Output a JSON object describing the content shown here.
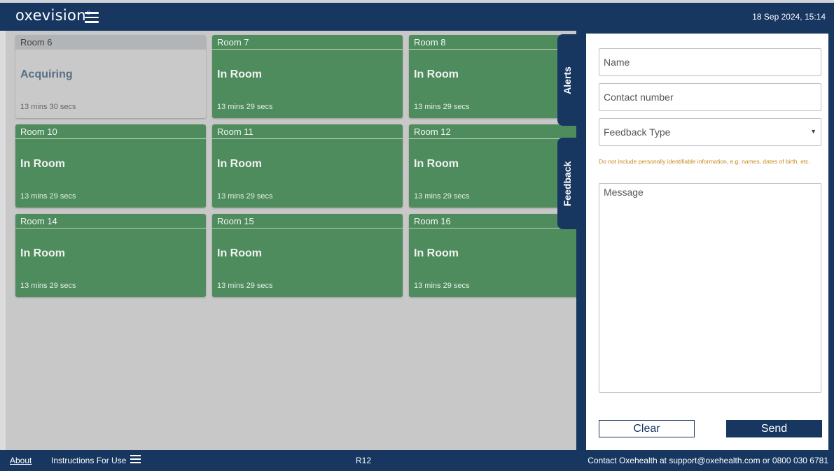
{
  "header": {
    "logo_text": "oxevision",
    "logo_mark": "®",
    "datetime": "18 Sep 2024, 15:14"
  },
  "rooms": [
    {
      "name": "Room 6",
      "status": "Acquiring",
      "duration": "13 mins 30 secs",
      "state": "acquiring"
    },
    {
      "name": "Room 7",
      "status": "In Room",
      "duration": "13 mins 29 secs",
      "state": "in-room"
    },
    {
      "name": "Room 8",
      "status": "In Room",
      "duration": "13 mins 29 secs",
      "state": "in-room"
    },
    {
      "name": "Room 10",
      "status": "In Room",
      "duration": "13 mins 29 secs",
      "state": "in-room"
    },
    {
      "name": "Room 11",
      "status": "In Room",
      "duration": "13 mins 29 secs",
      "state": "in-room"
    },
    {
      "name": "Room 12",
      "status": "In Room",
      "duration": "13 mins 29 secs",
      "state": "in-room"
    },
    {
      "name": "Room 14",
      "status": "In Room",
      "duration": "13 mins 29 secs",
      "state": "in-room"
    },
    {
      "name": "Room 15",
      "status": "In Room",
      "duration": "13 mins 29 secs",
      "state": "in-room"
    },
    {
      "name": "Room 16",
      "status": "In Room",
      "duration": "13 mins 29 secs",
      "state": "in-room"
    }
  ],
  "side_tabs": {
    "alerts": "Alerts",
    "feedback": "Feedback"
  },
  "feedback_form": {
    "name_placeholder": "Name",
    "contact_placeholder": "Contact number",
    "type_selected": "Feedback Type",
    "warning": "Do not include personally identifiable information, e.g. names, dates of birth, etc.",
    "message_placeholder": "Message",
    "clear_label": "Clear",
    "send_label": "Send"
  },
  "footer": {
    "about": "About",
    "instructions": "Instructions For Use",
    "room_code": "R12",
    "contact": "Contact Oxehealth at support@oxehealth.com or 0800 030 6781"
  },
  "colors": {
    "navy": "#173761",
    "tile_green": "#4e8c5d",
    "acquiring_grey": "#c9c9c9",
    "warning_orange": "#c78a1c"
  }
}
